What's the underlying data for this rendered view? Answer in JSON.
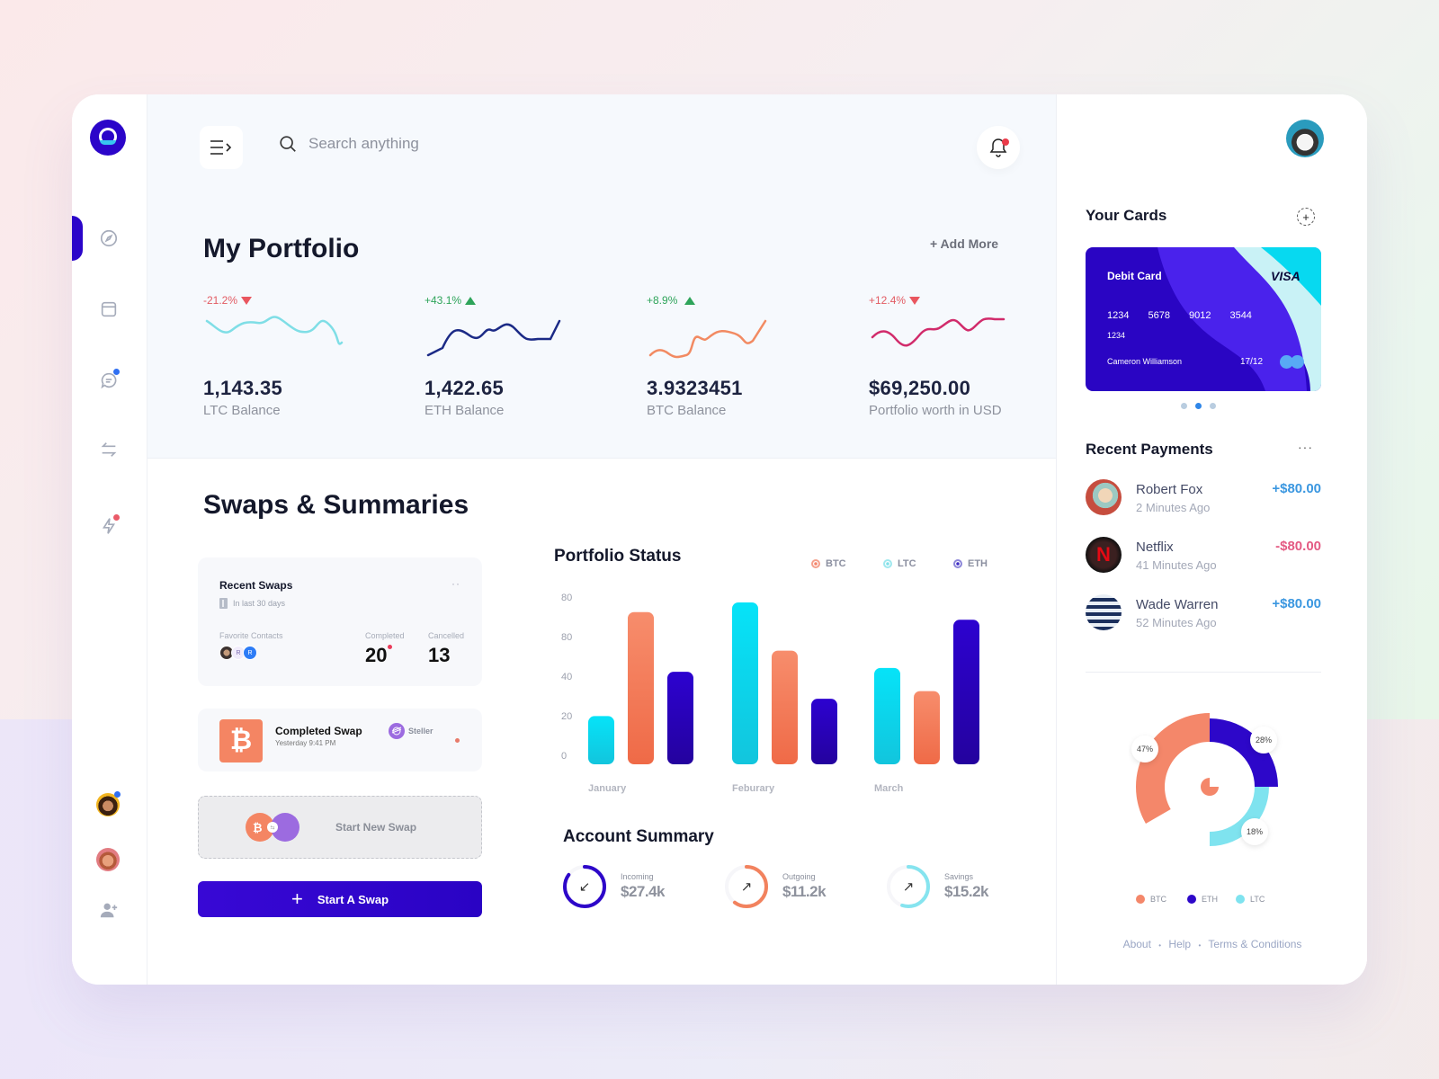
{
  "header": {
    "search_placeholder": "Search anything"
  },
  "portfolio": {
    "title": "My Portfolio",
    "add_more": "+ Add More",
    "stats": [
      {
        "change": "-21.2%",
        "direction": "down",
        "value": "1,143.35",
        "label": "LTC Balance",
        "color": "#7fdee6"
      },
      {
        "change": "+43.1%",
        "direction": "up",
        "value": "1,422.65",
        "label": "ETH Balance",
        "color": "#1b2a86"
      },
      {
        "change": "+8.9%",
        "direction": "up",
        "value": "3.9323451",
        "label": "BTC Balance",
        "color": "#f28a62"
      },
      {
        "change": "+12.4%",
        "direction": "down",
        "value": "$69,250.00",
        "label": "Portfolio worth in USD",
        "color": "#d12b6b"
      }
    ]
  },
  "swaps": {
    "title": "Swaps & Summaries",
    "recent": {
      "title": "Recent Swaps",
      "subtitle": "In last 30 days",
      "more": "··",
      "favorite_label": "Favorite Contacts",
      "contacts": [
        "",
        "R",
        "R"
      ],
      "completed_label": "Completed",
      "completed_value": "20",
      "cancelled_label": "Cancelled",
      "cancelled_value": "13"
    },
    "completed_swap": {
      "title": "Completed Swap",
      "time": "Yesterday 9:41 PM",
      "coin": "Steller",
      "btc_glyph": "₿"
    },
    "start_new": "Start New Swap",
    "start_button": "Start A Swap"
  },
  "portfolio_status": {
    "title": "Portfolio Status",
    "legend": [
      {
        "name": "BTC",
        "color": "#f4846a"
      },
      {
        "name": "LTC",
        "color": "#7fdfe9"
      },
      {
        "name": "ETH",
        "color": "#3c2bc4"
      }
    ]
  },
  "chart_data": {
    "type": "bar",
    "title": "Portfolio Status",
    "categories": [
      "January",
      "Feburary",
      "March"
    ],
    "series": [
      {
        "name": "LTC",
        "values": [
          25,
          84,
          50
        ],
        "colors": [
          "#06e3f8",
          "#12c5dd"
        ]
      },
      {
        "name": "BTC",
        "values": [
          79,
          59,
          38
        ],
        "colors": [
          "#f78d6c",
          "#ef6a47"
        ]
      },
      {
        "name": "ETH",
        "values": [
          48,
          34,
          75
        ],
        "colors": [
          "#2d02d0",
          "#24029e"
        ]
      }
    ],
    "yticks": [
      "0",
      "20",
      "40",
      "80",
      "80"
    ],
    "ylim": [
      0,
      84
    ],
    "grid": false,
    "legend": "top-right"
  },
  "account_summary": {
    "title": "Account Summary",
    "items": [
      {
        "label": "Incoming",
        "value": "$27.4k",
        "color": "#2d07c9",
        "arrow": "↙",
        "progress": 0.85
      },
      {
        "label": "Outgoing",
        "value": "$11.2k",
        "color": "#f2825e",
        "arrow": "↗",
        "progress": 0.6
      },
      {
        "label": "Savings",
        "value": "$15.2k",
        "color": "#86e4ef",
        "arrow": "↗",
        "progress": 0.55
      }
    ]
  },
  "cards": {
    "title": "Your Cards",
    "add": "+",
    "card": {
      "type": "Debit Card",
      "brand": "VISA",
      "number": [
        "1234",
        "5678",
        "9012",
        "3544"
      ],
      "number_extra": "1234",
      "holder": "Cameron Williamson",
      "expiry": "17/12"
    },
    "pager_active": 1,
    "pager_count": 3
  },
  "payments": {
    "title": "Recent Payments",
    "more": "···",
    "items": [
      {
        "name": "Robert Fox",
        "time": "2 Minutes Ago",
        "amount": "+$80.00",
        "positive": true
      },
      {
        "name": "Netflix",
        "time": "41 Minutes Ago",
        "amount": "-$80.00",
        "positive": false
      },
      {
        "name": "Wade Warren",
        "time": "52 Minutes Ago",
        "amount": "+$80.00",
        "positive": true
      }
    ]
  },
  "allocation": {
    "slices": [
      {
        "name": "BTC",
        "percent": 47,
        "label": "47%",
        "color": "#f4876a"
      },
      {
        "name": "ETH",
        "percent": 28,
        "label": "28%",
        "color": "#2d07c9"
      },
      {
        "name": "LTC",
        "percent": 18,
        "label": "18%",
        "color": "#7fe3ef"
      }
    ]
  },
  "footer": {
    "links": [
      "About",
      "Help",
      "Terms & Conditions"
    ],
    "sep": "•"
  }
}
